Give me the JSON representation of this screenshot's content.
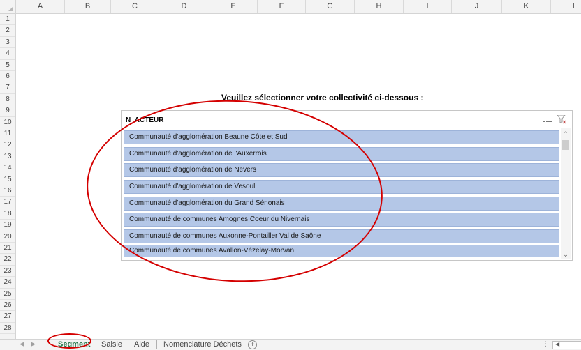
{
  "columns": [
    "A",
    "B",
    "C",
    "D",
    "E",
    "F",
    "G",
    "H",
    "I",
    "J",
    "K",
    "L"
  ],
  "rows": [
    "1",
    "2",
    "3",
    "4",
    "5",
    "6",
    "7",
    "8",
    "9",
    "10",
    "11",
    "12",
    "13",
    "14",
    "15",
    "16",
    "17",
    "18",
    "19",
    "20",
    "21",
    "22",
    "23",
    "24",
    "25",
    "26",
    "27",
    "28"
  ],
  "prompt": "Veuillez sélectionner votre collectivité ci-dessous :",
  "slicer": {
    "title": "N_ACTEUR",
    "multiselect_icon": "multi-select-icon",
    "clear_filter_icon": "clear-filter-icon",
    "items": [
      "Communauté d'agglomération Beaune Côte et Sud",
      "Communauté d'agglomération de l'Auxerrois",
      "Communauté d'agglomération de Nevers",
      "Communauté d'agglomération de Vesoul",
      "Communauté d'agglomération du Grand Sénonais",
      "Communauté de communes Amognes Coeur du Nivernais",
      "Communauté de communes Auxonne-Pontailler Val de Saône",
      "Communauté de communes Avallon-Vézelay-Morvan"
    ],
    "item_color": "#b4c7e7"
  },
  "annotation_color": "#d40000",
  "sheet_tabs": [
    "Segment",
    "Saisie",
    "Aide",
    "Nomenclature Déchets"
  ],
  "active_tab": "Segment",
  "add_sheet_label": "+",
  "accent_color": "#217346"
}
